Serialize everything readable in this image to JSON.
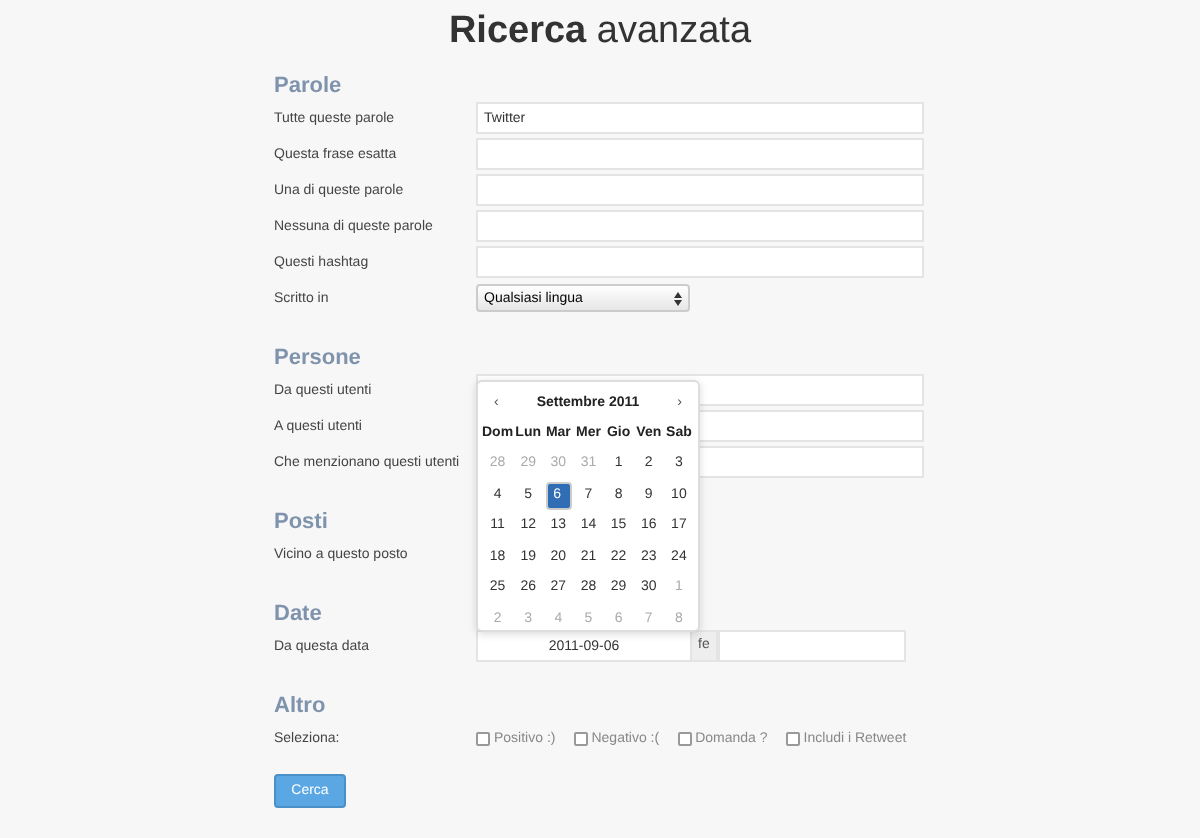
{
  "title": {
    "bold": "Ricerca",
    "rest": "avanzata"
  },
  "sections": [
    {
      "heading": "Parole",
      "rows": [
        {
          "kind": "text",
          "label": "Tutte queste parole",
          "value": "Twitter"
        },
        {
          "kind": "text",
          "label": "Questa frase esatta",
          "value": ""
        },
        {
          "kind": "text",
          "label": "Una di queste parole",
          "value": ""
        },
        {
          "kind": "text",
          "label": "Nessuna di queste parole",
          "value": ""
        },
        {
          "kind": "text",
          "label": "Questi hashtag",
          "value": ""
        },
        {
          "kind": "select",
          "label": "Scritto in",
          "value": "Qualsiasi lingua"
        }
      ]
    },
    {
      "heading": "Persone",
      "rows": [
        {
          "kind": "text",
          "label": "Da questi utenti",
          "value": ""
        },
        {
          "kind": "text",
          "label": "A questi utenti",
          "value": ""
        },
        {
          "kind": "text",
          "label": "Che menzionano questi utenti",
          "value": ""
        }
      ]
    },
    {
      "heading": "Posti",
      "rows": [
        {
          "kind": "hidden",
          "label": "Vicino a questo posto"
        }
      ]
    },
    {
      "heading": "Date",
      "rows": [
        {
          "kind": "daterange",
          "label": "Da questa data",
          "value": "2011-09-06",
          "addon": "fe"
        }
      ]
    },
    {
      "heading": "Altro",
      "rows": [
        {
          "kind": "checks",
          "label": "Seleziona:",
          "options": [
            {
              "label": "Positivo :)",
              "checked": false
            },
            {
              "label": "Negativo :(",
              "checked": false
            },
            {
              "label": "Domanda ?",
              "checked": false
            },
            {
              "label": "Includi i Retweet",
              "checked": false
            }
          ]
        }
      ]
    }
  ],
  "calendar": {
    "prev": "‹",
    "month": "Settembre 2011",
    "next": "›",
    "weekdays": [
      "Dom",
      "Lun",
      "Mar",
      "Mer",
      "Gio",
      "Ven",
      "Sab"
    ],
    "weeks": [
      [
        {
          "day": "28",
          "muted": true,
          "selected": false
        },
        {
          "day": "29",
          "muted": true,
          "selected": false
        },
        {
          "day": "30",
          "muted": true,
          "selected": false
        },
        {
          "day": "31",
          "muted": true,
          "selected": false
        },
        {
          "day": "1",
          "muted": false,
          "selected": false
        },
        {
          "day": "2",
          "muted": false,
          "selected": false
        },
        {
          "day": "3",
          "muted": false,
          "selected": false
        }
      ],
      [
        {
          "day": "4",
          "muted": false,
          "selected": false
        },
        {
          "day": "5",
          "muted": false,
          "selected": false
        },
        {
          "day": "6",
          "muted": false,
          "selected": true
        },
        {
          "day": "7",
          "muted": false,
          "selected": false
        },
        {
          "day": "8",
          "muted": false,
          "selected": false
        },
        {
          "day": "9",
          "muted": false,
          "selected": false
        },
        {
          "day": "10",
          "muted": false,
          "selected": false
        }
      ],
      [
        {
          "day": "11",
          "muted": false,
          "selected": false
        },
        {
          "day": "12",
          "muted": false,
          "selected": false
        },
        {
          "day": "13",
          "muted": false,
          "selected": false
        },
        {
          "day": "14",
          "muted": false,
          "selected": false
        },
        {
          "day": "15",
          "muted": false,
          "selected": false
        },
        {
          "day": "16",
          "muted": false,
          "selected": false
        },
        {
          "day": "17",
          "muted": false,
          "selected": false
        }
      ],
      [
        {
          "day": "18",
          "muted": false,
          "selected": false
        },
        {
          "day": "19",
          "muted": false,
          "selected": false
        },
        {
          "day": "20",
          "muted": false,
          "selected": false
        },
        {
          "day": "21",
          "muted": false,
          "selected": false
        },
        {
          "day": "22",
          "muted": false,
          "selected": false
        },
        {
          "day": "23",
          "muted": false,
          "selected": false
        },
        {
          "day": "24",
          "muted": false,
          "selected": false
        }
      ],
      [
        {
          "day": "25",
          "muted": false,
          "selected": false
        },
        {
          "day": "26",
          "muted": false,
          "selected": false
        },
        {
          "day": "27",
          "muted": false,
          "selected": false
        },
        {
          "day": "28",
          "muted": false,
          "selected": false
        },
        {
          "day": "29",
          "muted": false,
          "selected": false
        },
        {
          "day": "30",
          "muted": false,
          "selected": false
        },
        {
          "day": "1",
          "muted": true,
          "selected": false
        }
      ],
      [
        {
          "day": "2",
          "muted": true,
          "selected": false
        },
        {
          "day": "3",
          "muted": true,
          "selected": false
        },
        {
          "day": "4",
          "muted": true,
          "selected": false
        },
        {
          "day": "5",
          "muted": true,
          "selected": false
        },
        {
          "day": "6",
          "muted": true,
          "selected": false
        },
        {
          "day": "7",
          "muted": true,
          "selected": false
        },
        {
          "day": "8",
          "muted": true,
          "selected": false
        }
      ]
    ]
  },
  "submit": "Cerca"
}
